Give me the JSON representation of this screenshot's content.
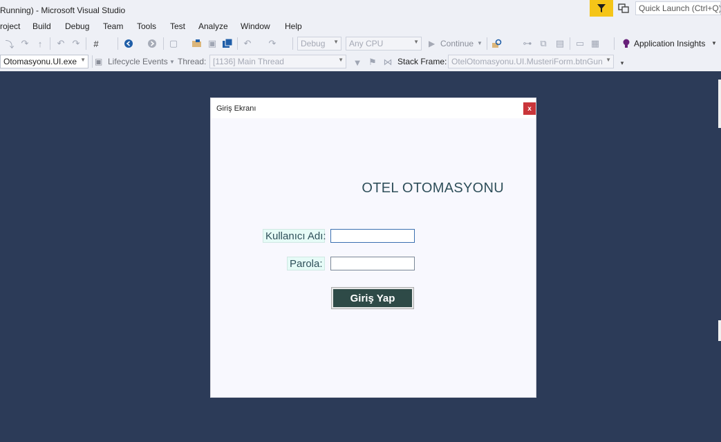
{
  "window": {
    "title": "Running) - Microsoft Visual Studio",
    "quick_launch_placeholder": "Quick Launch (Ctrl+Q)"
  },
  "menu": [
    "roject",
    "Build",
    "Debug",
    "Team",
    "Tools",
    "Test",
    "Analyze",
    "Window",
    "Help"
  ],
  "toolbar": {
    "configuration": "Debug",
    "platform": "Any CPU",
    "continue_label": "Continue",
    "application_insights_label": "Application Insights"
  },
  "debug_location": {
    "process": "Otomasyonu.UI.exe",
    "lifecycle_events_label": "Lifecycle Events",
    "thread_label": "Thread:",
    "thread_value": "[1136] Main Thread",
    "stack_frame_label": "Stack Frame:",
    "stack_frame_value": "OtelOtomasyonu.UI.MusteriForm.btnGun"
  },
  "dialog": {
    "title": "Giriş Ekranı",
    "close_label": "x",
    "heading": "OTEL OTOMASYONU",
    "username_label": "Kullanıcı Adı:",
    "username_value": "",
    "password_label": "Parola:",
    "password_value": "",
    "login_button_label": "Giriş Yap"
  },
  "colors": {
    "editor_background": "#2c3b58",
    "notification_flag": "#f5c518",
    "close_button": "#c9353a",
    "login_button": "#2e4a47",
    "label_background": "#e6fbf7"
  }
}
